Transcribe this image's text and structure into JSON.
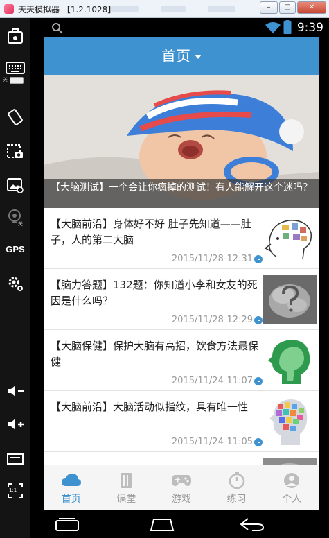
{
  "window": {
    "title": "天天模拟器 【1.2.1028】"
  },
  "status_bar": {
    "time": "9:39"
  },
  "app_bar": {
    "title": "首页"
  },
  "banner": {
    "caption": "【大脑测试】一个会让你疯掉的测试！有人能解开这个迷吗？"
  },
  "news": [
    {
      "headline": "【大脑前沿】身体好不好 肚子先知道——肚子，人的第二大脑",
      "date": "2015/11/28-12:31"
    },
    {
      "headline": "【脑力答题】132题：你知道小李和女友的死因是什么吗？",
      "date": "2015/11/28-12:29"
    },
    {
      "headline": "【大脑保健】保护大脑有高招，饮食方法最保健",
      "date": "2015/11/24-11:07"
    },
    {
      "headline": "【大脑前沿】大脑活动似指纹，具有唯一性",
      "date": "2015/11/24-11:05"
    }
  ],
  "tabs": [
    {
      "label": "首页",
      "icon": "cloud-icon",
      "active": true
    },
    {
      "label": "课堂",
      "icon": "book-icon",
      "active": false
    },
    {
      "label": "游戏",
      "icon": "gamepad-icon",
      "active": false
    },
    {
      "label": "练习",
      "icon": "stopwatch-icon",
      "active": false
    },
    {
      "label": "个人",
      "icon": "person-icon",
      "active": false
    }
  ],
  "sidebar": {
    "keyboard_toggle": "关",
    "camera_toggle": "关",
    "gps_label": "GPS",
    "ratio_label": "1:1"
  },
  "colors": {
    "accent": "#3e92cf",
    "tab_inactive": "#9a9a9a",
    "sidebar_bg": "#141414"
  }
}
